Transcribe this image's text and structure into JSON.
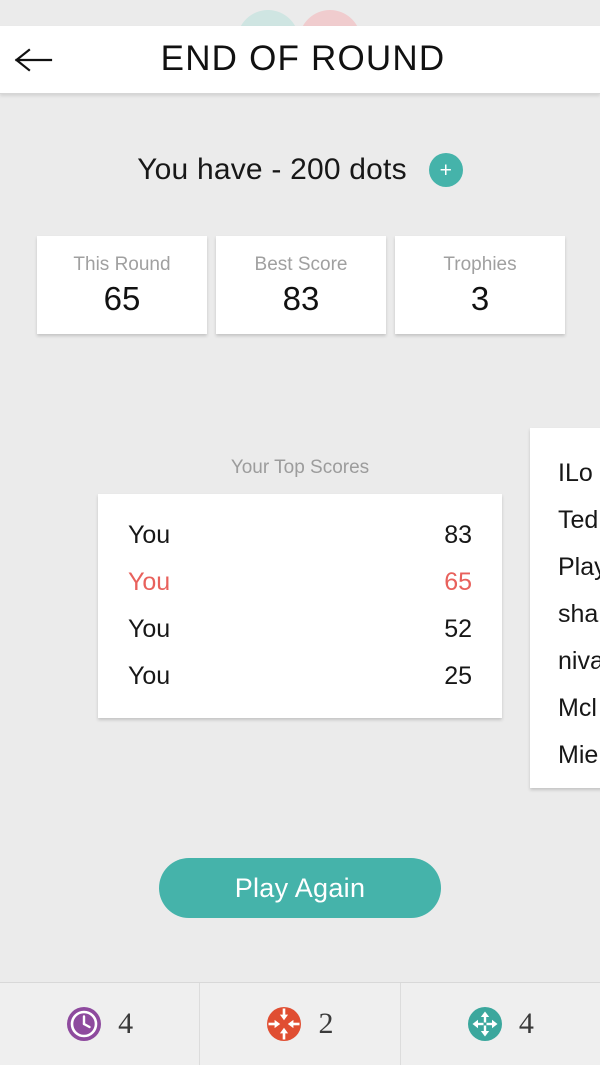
{
  "header": {
    "back_icon": "arrow-left-icon",
    "title": "END OF ROUND"
  },
  "decor": {
    "teal_circle_color": "#cfe5e2",
    "pink_circle_color": "#f0ccce"
  },
  "currency": {
    "text": "You have - 200 dots",
    "amount": "200",
    "unit": "dots",
    "add_button_label": "+",
    "add_button_icon": "plus-icon"
  },
  "stats": [
    {
      "label": "This Round",
      "value": "65"
    },
    {
      "label": "Best Score",
      "value": "83"
    },
    {
      "label": "Trophies",
      "value": "3"
    }
  ],
  "top_scores": {
    "title": "Your Top Scores",
    "rows": [
      {
        "name": "You",
        "score": "83",
        "highlight": false
      },
      {
        "name": "You",
        "score": "65",
        "highlight": true
      },
      {
        "name": "You",
        "score": "52",
        "highlight": false
      },
      {
        "name": "You",
        "score": "25",
        "highlight": false
      }
    ],
    "highlight_color": "#e8615c"
  },
  "leaderboard_peek": {
    "rows": [
      {
        "name": "ILo"
      },
      {
        "name": "Ted"
      },
      {
        "name": "Play"
      },
      {
        "name": "sha"
      },
      {
        "name": "niva"
      },
      {
        "name": "Mcl"
      },
      {
        "name": "Mie"
      }
    ]
  },
  "play_again": {
    "label": "Play Again",
    "color": "#45b3aa"
  },
  "powerups": [
    {
      "icon": "clock-icon",
      "count": "4",
      "color": "#8e4a9e"
    },
    {
      "icon": "shrink-target-icon",
      "count": "2",
      "color": "#e04e32"
    },
    {
      "icon": "expand-arrows-icon",
      "count": "4",
      "color": "#3ba79d"
    }
  ]
}
